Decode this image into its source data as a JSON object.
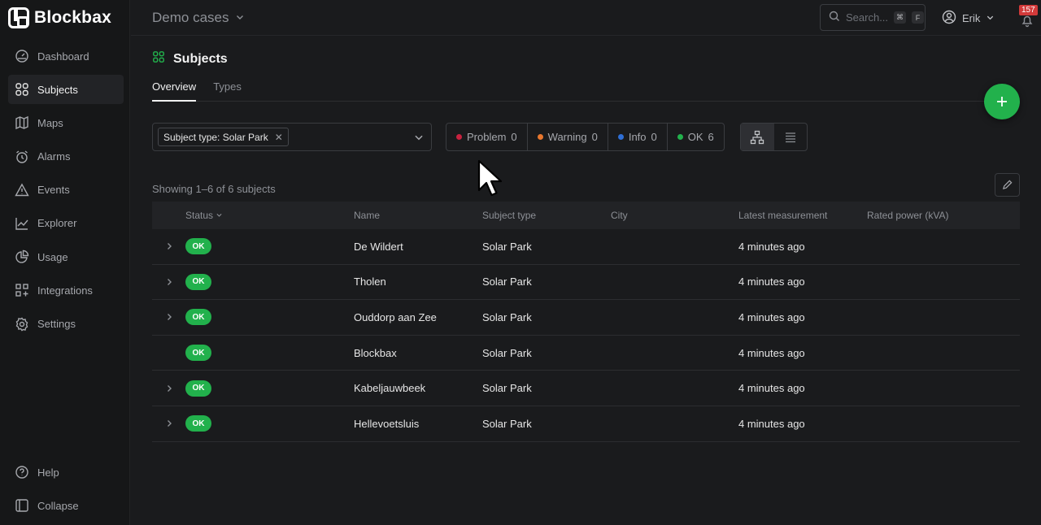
{
  "app": {
    "logo_text": "Blockbax"
  },
  "sidebar": {
    "items": [
      {
        "label": "Dashboard",
        "icon": "dashboard-icon",
        "active": false
      },
      {
        "label": "Subjects",
        "icon": "subjects-icon",
        "active": true
      },
      {
        "label": "Maps",
        "icon": "map-icon",
        "active": false
      },
      {
        "label": "Alarms",
        "icon": "alarm-icon",
        "active": false
      },
      {
        "label": "Events",
        "icon": "warning-icon",
        "active": false
      },
      {
        "label": "Explorer",
        "icon": "chart-icon",
        "active": false
      },
      {
        "label": "Usage",
        "icon": "pie-icon",
        "active": false
      },
      {
        "label": "Integrations",
        "icon": "integrations-icon",
        "active": false
      },
      {
        "label": "Settings",
        "icon": "gear-icon",
        "active": false
      }
    ],
    "bottom": [
      {
        "label": "Help",
        "icon": "help-icon"
      },
      {
        "label": "Collapse",
        "icon": "collapse-icon"
      }
    ]
  },
  "topbar": {
    "project": "Demo cases",
    "search_placeholder": "Search...",
    "search_kbd_1": "⌘",
    "search_kbd_2": "F",
    "user": "Erik",
    "notification_count": "157"
  },
  "page": {
    "title": "Subjects",
    "tabs": [
      "Overview",
      "Types"
    ],
    "active_tab": "Overview",
    "filter_chip": "Subject type: Solar Park",
    "status_filters": [
      {
        "label": "Problem",
        "count": "0",
        "color": "#c8223f"
      },
      {
        "label": "Warning",
        "count": "0",
        "color": "#e8772e"
      },
      {
        "label": "Info",
        "count": "0",
        "color": "#2f6fd6"
      },
      {
        "label": "OK",
        "count": "6",
        "color": "#22b14c"
      }
    ],
    "showing_text": "Showing 1–6 of 6 subjects"
  },
  "table": {
    "headers": {
      "status": "Status",
      "name": "Name",
      "subject_type": "Subject type",
      "city": "City",
      "latest": "Latest measurement",
      "power": "Rated power (kVA)"
    },
    "rows": [
      {
        "status": "OK",
        "name": "De Wildert",
        "type": "Solar Park",
        "city": "",
        "latest": "4 minutes ago",
        "power": "",
        "expandable": true
      },
      {
        "status": "OK",
        "name": "Tholen",
        "type": "Solar Park",
        "city": "",
        "latest": "4 minutes ago",
        "power": "",
        "expandable": true
      },
      {
        "status": "OK",
        "name": "Ouddorp aan Zee",
        "type": "Solar Park",
        "city": "",
        "latest": "4 minutes ago",
        "power": "",
        "expandable": true
      },
      {
        "status": "OK",
        "name": "Blockbax",
        "type": "Solar Park",
        "city": "",
        "latest": "4 minutes ago",
        "power": "",
        "expandable": false
      },
      {
        "status": "OK",
        "name": "Kabeljauwbeek",
        "type": "Solar Park",
        "city": "",
        "latest": "4 minutes ago",
        "power": "",
        "expandable": true
      },
      {
        "status": "OK",
        "name": "Hellevoetsluis",
        "type": "Solar Park",
        "city": "",
        "latest": "4 minutes ago",
        "power": "",
        "expandable": true
      }
    ]
  },
  "colors": {
    "accent": "#22b14c",
    "ok": "#22b14c",
    "badge": "#d23a3a"
  }
}
